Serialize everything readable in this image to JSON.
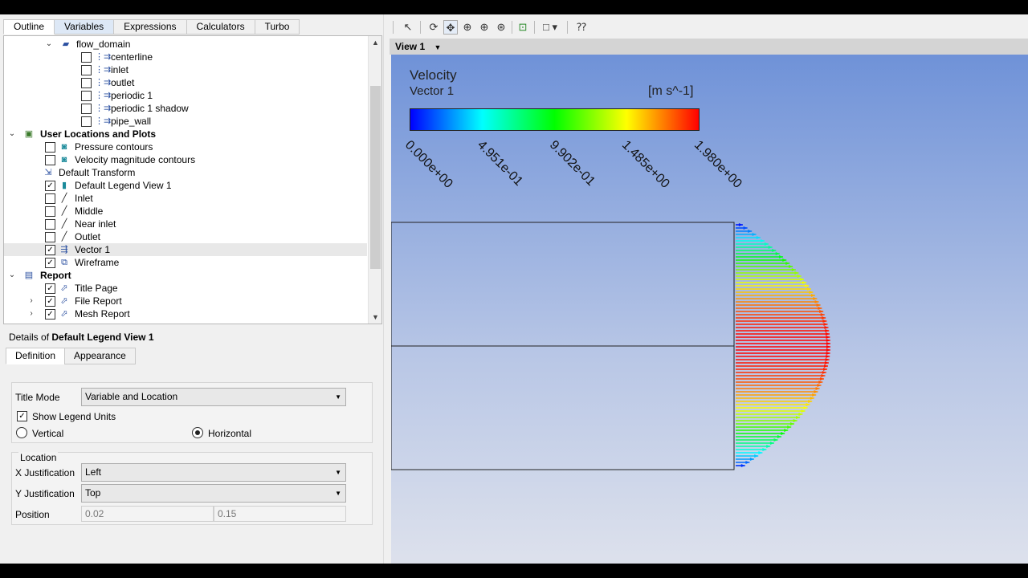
{
  "outline_tabs": [
    "Outline",
    "Variables",
    "Expressions",
    "Calculators",
    "Turbo"
  ],
  "tree": {
    "flow_domain": "flow_domain",
    "boundaries": [
      "centerline",
      "inlet",
      "outlet",
      "periodic 1",
      "periodic 1 shadow",
      "pipe_wall"
    ],
    "user_locations_header": "User Locations and Plots",
    "user_locations": [
      "Pressure contours",
      "Velocity magnitude contours",
      "Default Transform",
      "Default Legend View 1",
      "Inlet",
      "Middle",
      "Near inlet",
      "Outlet",
      "Vector 1",
      "Wireframe"
    ],
    "report_header": "Report",
    "report_items": [
      "Title Page",
      "File Report",
      "Mesh Report"
    ]
  },
  "details": {
    "prefix": "Details of ",
    "object": "Default Legend View 1",
    "tabs": [
      "Definition",
      "Appearance"
    ],
    "title_mode_label": "Title Mode",
    "title_mode_value": "Variable and Location",
    "show_units_label": "Show Legend Units",
    "vertical_label": "Vertical",
    "horizontal_label": "Horizontal",
    "location_group": "Location",
    "x_just_label": "X Justification",
    "x_just_value": "Left",
    "y_just_label": "Y Justification",
    "y_just_value": "Top",
    "position_label": "Position",
    "position_x": "0.02",
    "position_y": "0.15"
  },
  "view": {
    "name": "View 1",
    "legend_title": "Velocity",
    "legend_subtitle": "Vector 1",
    "legend_units": "[m s^-1]",
    "ticks": [
      "0.000e+00",
      "4.951e-01",
      "9.902e-01",
      "1.485e+00",
      "1.980e+00"
    ]
  },
  "colors": {
    "accent": "#dde8f6",
    "viewport_top": "#6f92d8",
    "viewport_bottom": "#dde1ec"
  }
}
